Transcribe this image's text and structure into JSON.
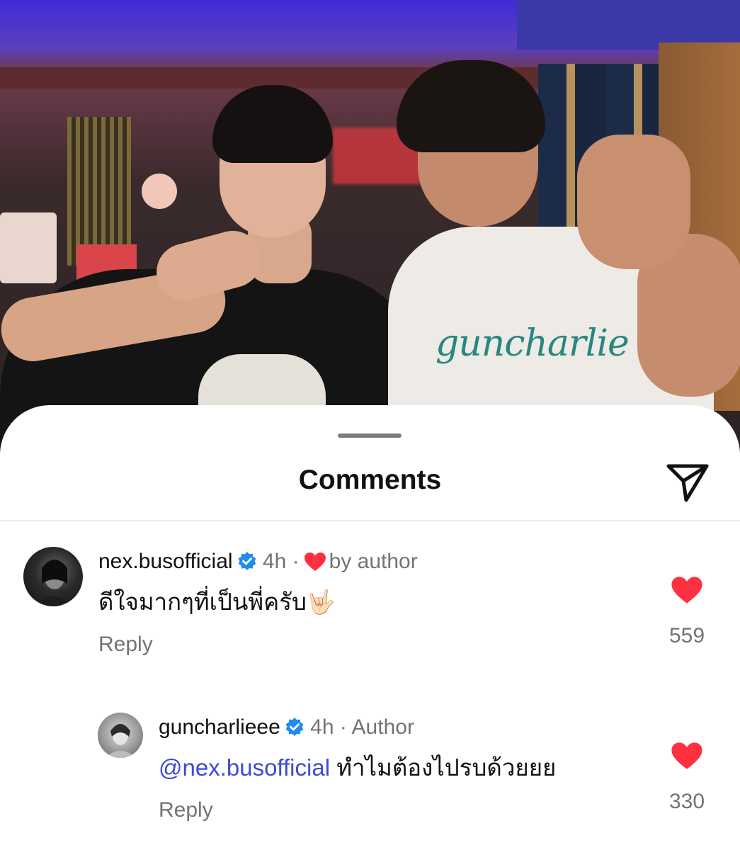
{
  "sheet": {
    "title": "Comments",
    "share_icon": "paper-plane-icon"
  },
  "comments": [
    {
      "username": "nex.busofficial",
      "verified": true,
      "time": "4h",
      "separator": "·",
      "note": "by author",
      "text": "ดีใจมากๆที่เป็นพี่ครับ🤟🏻",
      "reply_label": "Reply",
      "likes": "559"
    },
    {
      "username": "guncharlieee",
      "verified": true,
      "time": "4h",
      "separator": "·",
      "note": "Author",
      "mention": "@nex.busofficial",
      "text": "ทำไมต้องไปรบด้วยยย",
      "reply_label": "Reply",
      "likes": "330"
    }
  ],
  "colors": {
    "like_red": "#ff3040",
    "verified_blue": "#1f8cf0",
    "mention_blue": "#3d4bd6",
    "muted_gray": "#737373"
  }
}
